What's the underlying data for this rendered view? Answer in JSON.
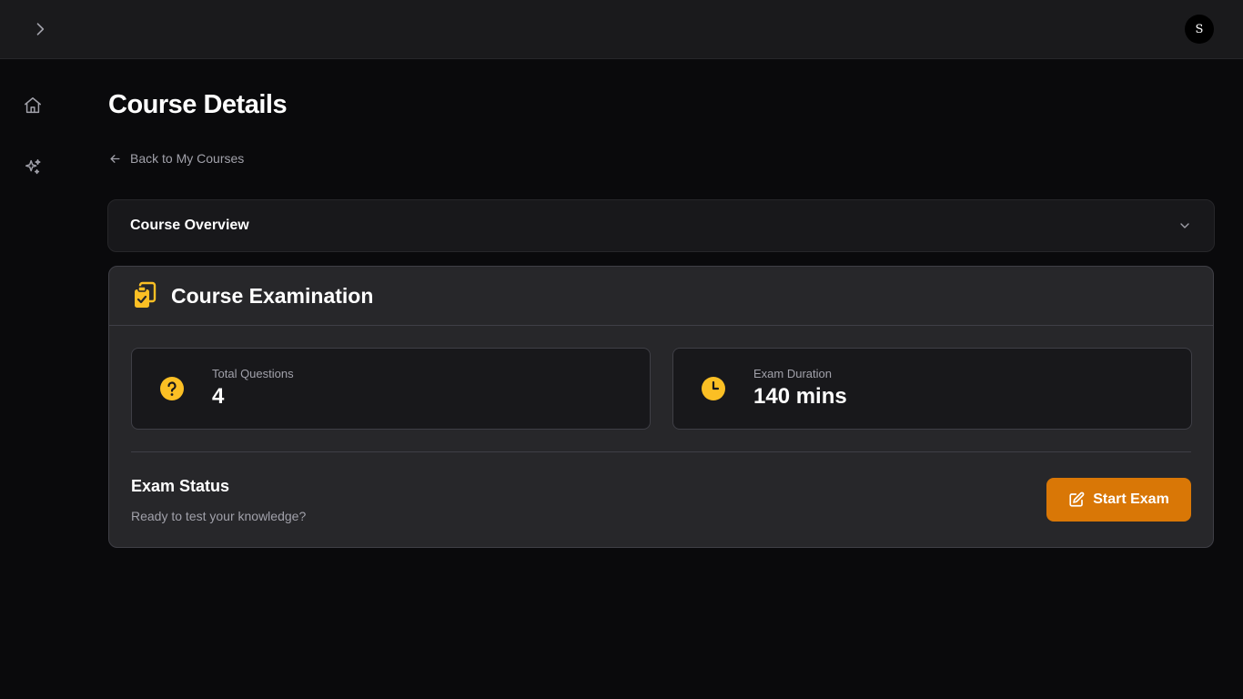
{
  "header": {
    "avatar_initial": "S"
  },
  "sidebar": {
    "items": [
      {
        "icon": "home-icon"
      },
      {
        "icon": "sparkles-icon"
      }
    ]
  },
  "page": {
    "title": "Course Details",
    "back_link": "Back to My Courses"
  },
  "overview": {
    "title": "Course Overview"
  },
  "exam": {
    "title": "Course Examination",
    "stats": [
      {
        "label": "Total Questions",
        "value": "4",
        "icon": "question-circle-icon"
      },
      {
        "label": "Exam Duration",
        "value": "140 mins",
        "icon": "clock-icon"
      }
    ],
    "status_title": "Exam Status",
    "status_desc": "Ready to test your knowledge?",
    "start_label": "Start Exam"
  },
  "colors": {
    "background": "#0a0a0c",
    "accent": "#d97706",
    "icon_yellow": "#fbbf24",
    "muted_text": "#a1a1aa"
  }
}
